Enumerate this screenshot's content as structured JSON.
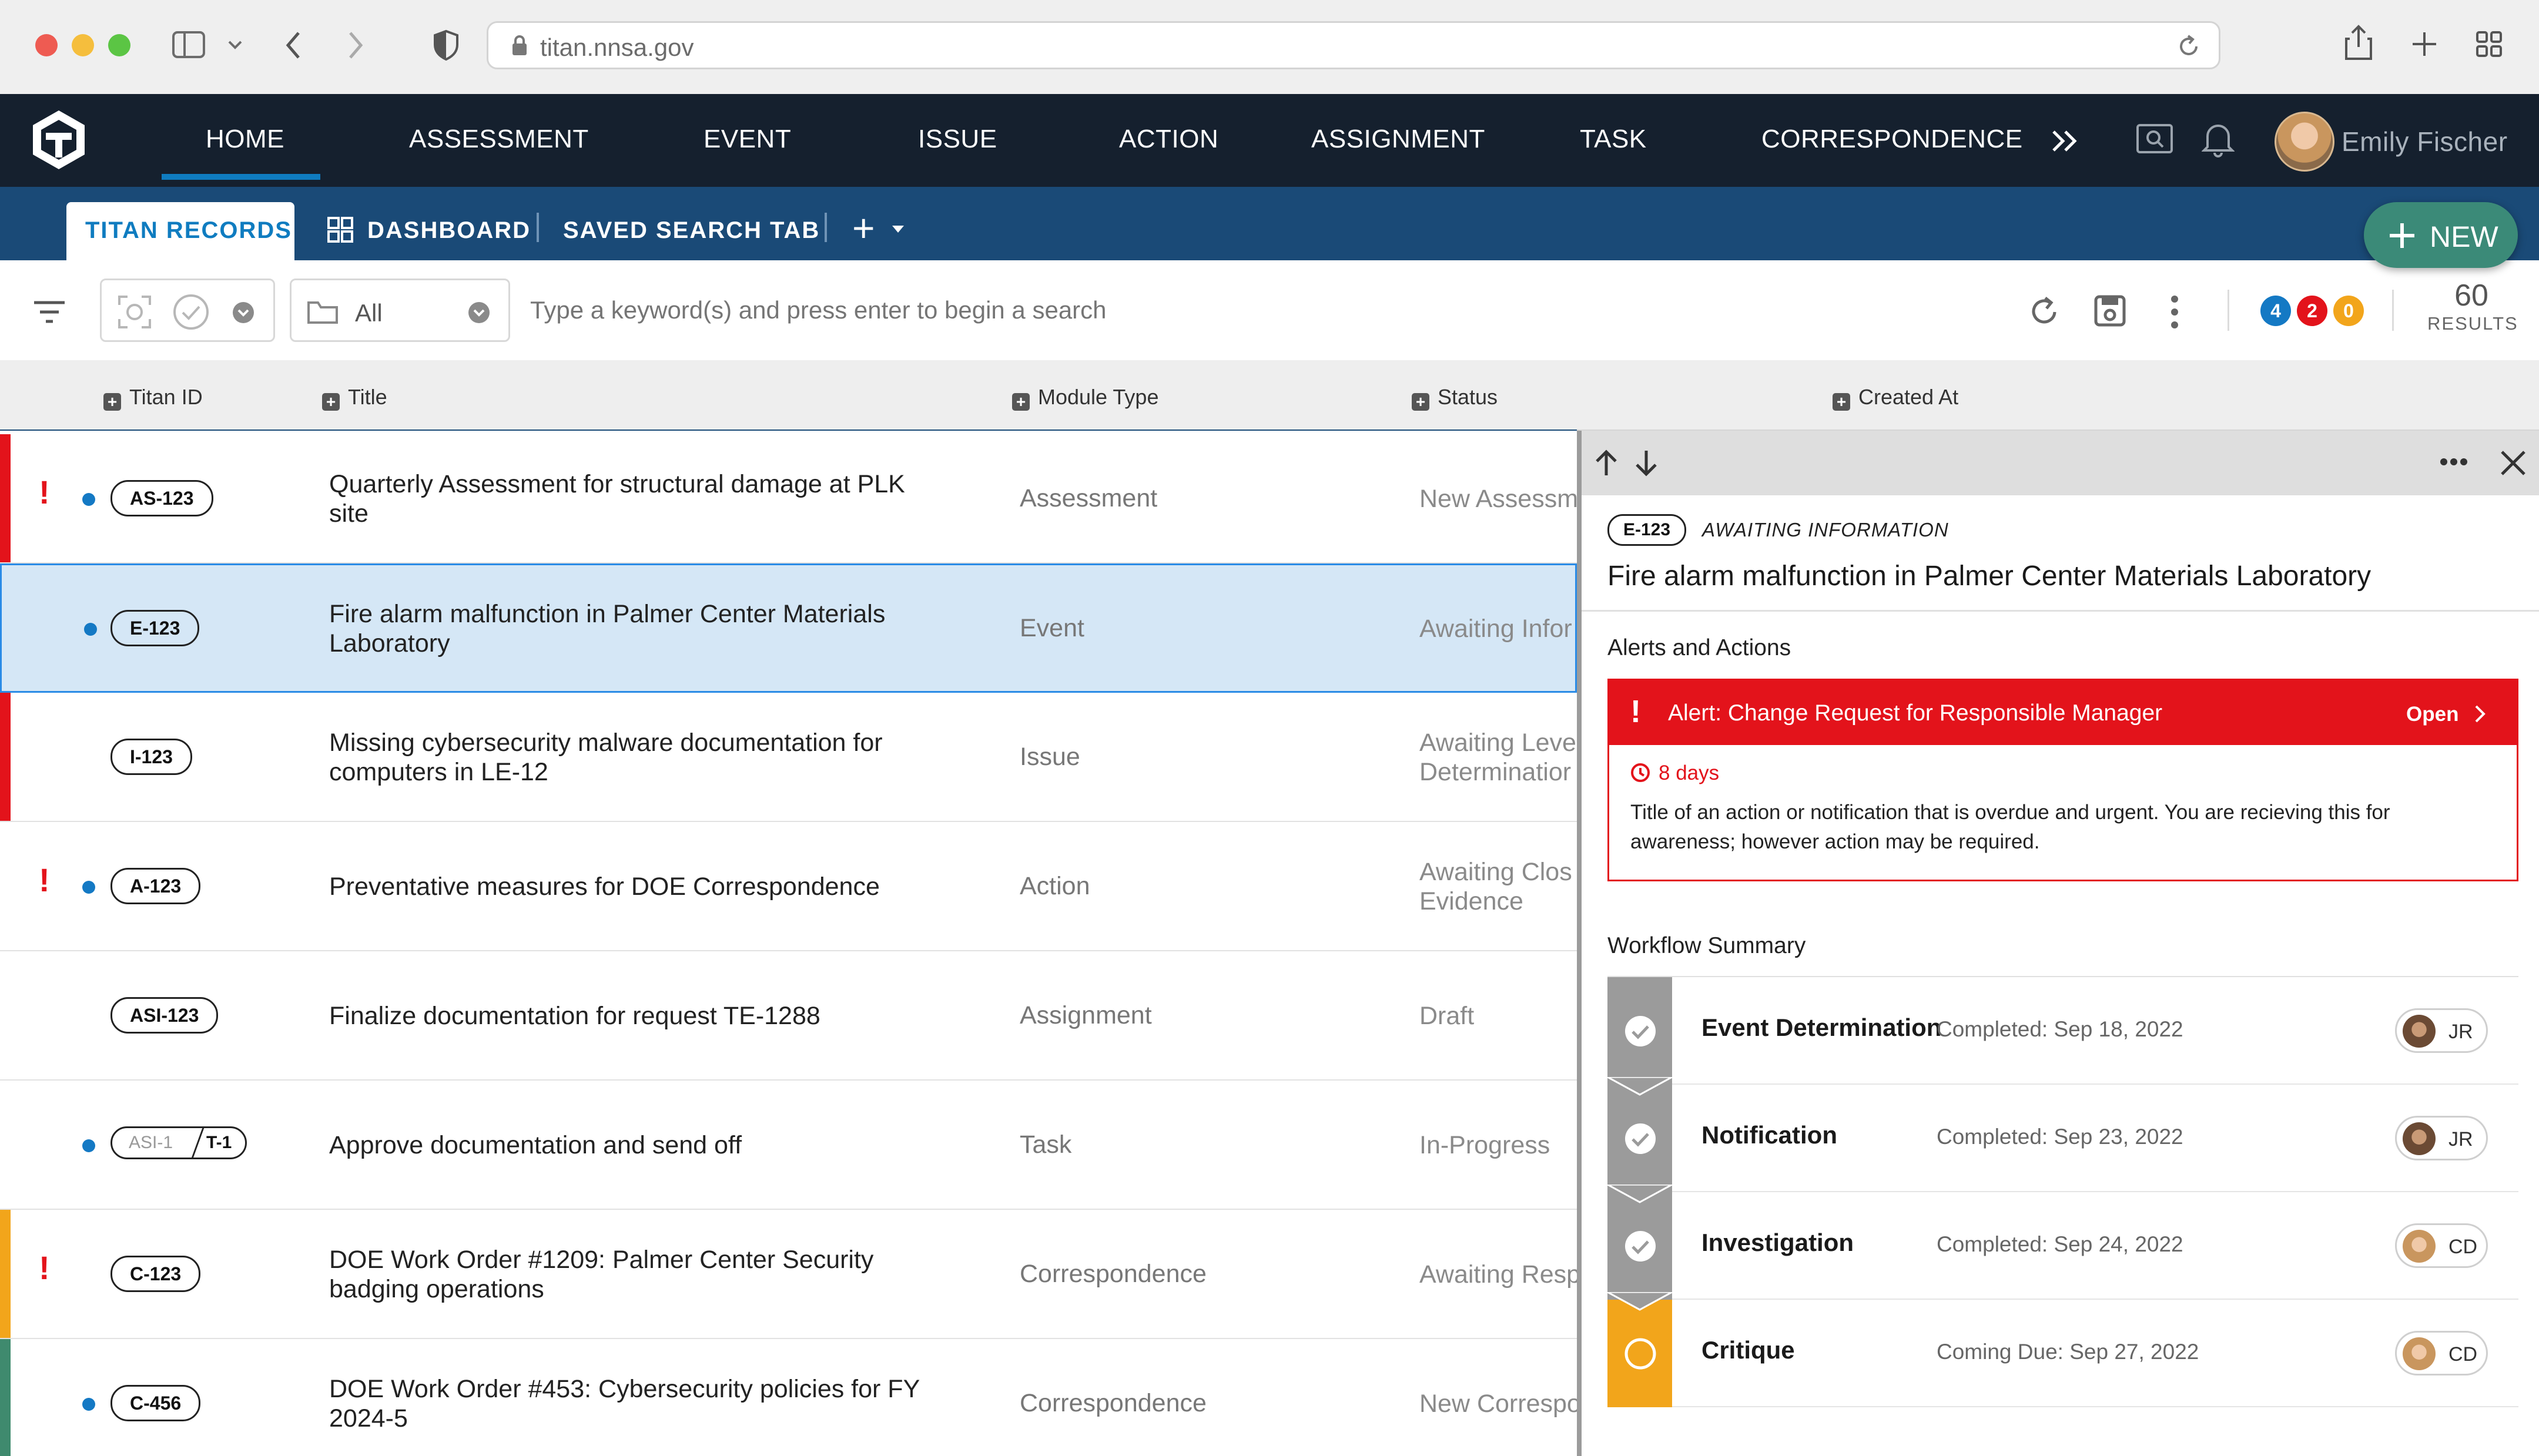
{
  "browser": {
    "url": "titan.nnsa.gov"
  },
  "nav": {
    "items": [
      "HOME",
      "ASSESSMENT",
      "EVENT",
      "ISSUE",
      "ACTION",
      "ASSIGNMENT",
      "TASK",
      "CORRESPONDENCE"
    ],
    "more": "»",
    "user": "Emily Fischer"
  },
  "tabs": {
    "titan_records": "TITAN RECORDS",
    "dashboard": "DASHBOARD",
    "saved_search": "SAVED SEARCH TAB",
    "add": "+",
    "new_button": "NEW"
  },
  "toolbar": {
    "folder_select": "All",
    "search_placeholder": "Type a keyword(s) and press enter to begin a search",
    "badges": [
      {
        "count": "4",
        "color": "#1479c4"
      },
      {
        "count": "2",
        "color": "#e3131b"
      },
      {
        "count": "0",
        "color": "#f2a51b"
      }
    ],
    "results_count": "60",
    "results_label": "RESULTS"
  },
  "columns": [
    "Titan ID",
    "Title",
    "Module Type",
    "Status",
    "Created At"
  ],
  "rows": [
    {
      "id": "AS-123",
      "title": "Quarterly Assessment for structural damage at PLK site",
      "module": "Assessment",
      "status": "New Assessm",
      "alert": true,
      "dot": true,
      "stripe": "#e3131b",
      "selected": false
    },
    {
      "id": "E-123",
      "title": "Fire alarm malfunction in Palmer Center Materials Laboratory",
      "module": "Event",
      "status": "Awaiting Infor",
      "alert": false,
      "dot": true,
      "stripe": "",
      "selected": true
    },
    {
      "id": "I-123",
      "title": "Missing cybersecurity malware documentation for computers in LE-12",
      "module": "Issue",
      "status": "Awaiting Leve\nDeterminatior",
      "alert": false,
      "dot": false,
      "stripe": "#e3131b",
      "selected": false
    },
    {
      "id": "A-123",
      "title": "Preventative measures for DOE Correspondence",
      "module": "Action",
      "status": "Awaiting Clos\nEvidence",
      "alert": true,
      "dot": true,
      "stripe": "",
      "selected": false
    },
    {
      "id": "ASI-123",
      "title": "Finalize documentation for request TE-1288",
      "module": "Assignment",
      "status": "Draft",
      "alert": false,
      "dot": false,
      "stripe": "",
      "selected": false
    },
    {
      "id": "T-1",
      "parent_id": "ASI-1",
      "title": "Approve documentation and send off",
      "module": "Task",
      "status": "In-Progress",
      "alert": false,
      "dot": true,
      "stripe": "",
      "selected": false
    },
    {
      "id": "C-123",
      "title": "DOE Work Order #1209: Palmer Center Security badging operations",
      "module": "Correspondence",
      "status": "Awaiting Resp",
      "alert": true,
      "dot": false,
      "stripe": "#f2a51b",
      "selected": false
    },
    {
      "id": "C-456",
      "title": "DOE Work Order #453: Cybersecurity policies for FY 2024-5",
      "module": "Correspondence",
      "status": "New Correspo",
      "alert": false,
      "dot": true,
      "stripe": "#3f8a6e",
      "selected": false
    }
  ],
  "detail": {
    "id": "E-123",
    "status": "AWAITING INFORMATION",
    "title": "Fire alarm malfunction in Palmer Center Materials Laboratory",
    "alerts_heading": "Alerts and Actions",
    "alert": {
      "title": "Alert: Change Request for Responsible Manager",
      "action": "Open",
      "due": "8 days",
      "body": "Title of an action or notification that is overdue and urgent. You are recieving this for awareness; however action may be required."
    },
    "workflow_heading": "Workflow Summary",
    "workflow": [
      {
        "name": "Event Determination",
        "date": "Completed: Sep 18, 2022",
        "assignee": "JR",
        "state": "done"
      },
      {
        "name": "Notification",
        "date": "Completed: Sep 23, 2022",
        "assignee": "JR",
        "state": "done"
      },
      {
        "name": "Investigation",
        "date": "Completed: Sep 24, 2022",
        "assignee": "CD",
        "state": "done"
      },
      {
        "name": "Critique",
        "date": "Coming Due: Sep 27, 2022",
        "assignee": "CD",
        "state": "pending"
      }
    ]
  },
  "colors": {
    "nav_bg": "#15202e",
    "tab_bg": "#1a4a77",
    "accent": "#0f7cc0",
    "alert": "#e3131b",
    "pending": "#f2a51b",
    "new_button": "#3b8a78"
  }
}
